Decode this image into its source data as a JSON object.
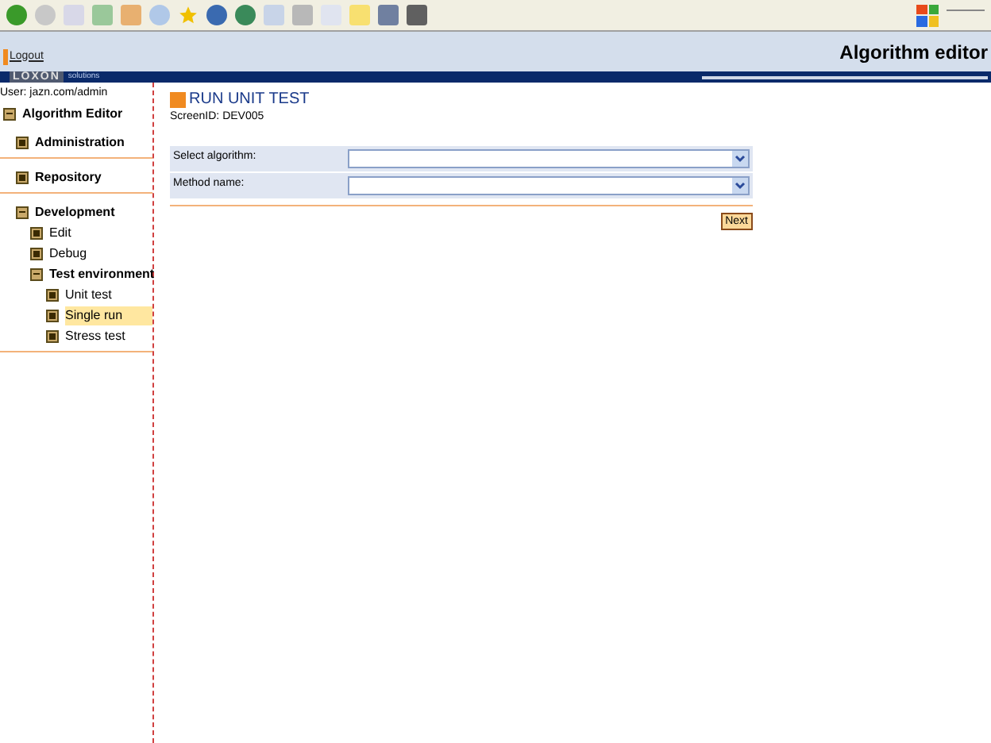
{
  "header": {
    "logout": "Logout",
    "title": "Algorithm editor",
    "logo": "LOXON",
    "logo_sub": "solutions"
  },
  "sidebar": {
    "user": "User: jazn.com/admin",
    "tree": [
      {
        "label": "Algorithm Editor",
        "expanded": true,
        "selected": false,
        "children": [
          {
            "label": "Administration",
            "expanded": false,
            "selected": false
          },
          {
            "label": "Repository",
            "expanded": false,
            "selected": false
          },
          {
            "label": "Development",
            "expanded": true,
            "selected": false,
            "children": [
              {
                "label": "Edit",
                "expanded": false,
                "selected": false
              },
              {
                "label": "Debug",
                "expanded": false,
                "selected": false
              },
              {
                "label": "Test environment",
                "expanded": true,
                "selected": false,
                "children": [
                  {
                    "label": "Unit test",
                    "expanded": false,
                    "selected": false
                  },
                  {
                    "label": "Single run",
                    "expanded": false,
                    "selected": true
                  },
                  {
                    "label": "Stress test",
                    "expanded": false,
                    "selected": false
                  }
                ]
              }
            ]
          }
        ]
      }
    ]
  },
  "page": {
    "title": "RUN UNIT TEST",
    "screen_id": "ScreenID: DEV005",
    "fields": [
      {
        "label": "Select algorithm:"
      },
      {
        "label": "Method name:"
      }
    ],
    "next_button": "Next"
  }
}
